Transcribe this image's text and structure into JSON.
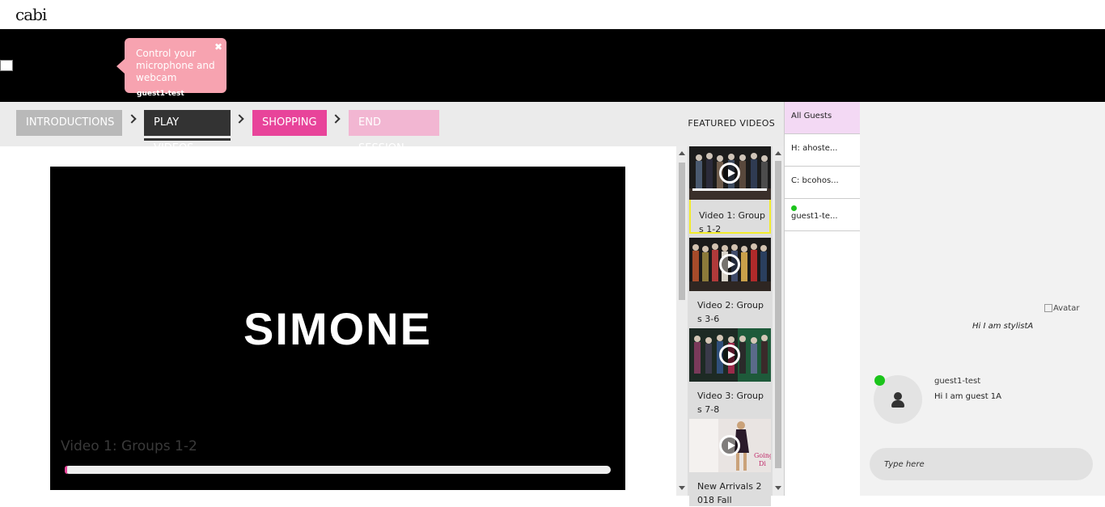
{
  "header": {
    "logo_text": "cabi"
  },
  "banner": {
    "tooltip_text": "Control your microphone and webcam",
    "tooltip_close": "✖",
    "guest_label": "guest1-test"
  },
  "steps": {
    "introductions": "INTRODUCTIONS",
    "play_videos": "PLAY VIDEOS",
    "shopping": "SHOPPING",
    "end_session": "END SESSION",
    "active": "PLAY VIDEOS",
    "featured_videos": "FEATURED VIDEOS"
  },
  "player": {
    "brand_text": "SIMONE",
    "title": "Video 1: Groups 1-2",
    "progress_fraction": 0.004
  },
  "videos": [
    {
      "label": "Video 1: Groups 1-2",
      "active": true,
      "progress_fraction": 1.0
    },
    {
      "label": "Video 2: Groups 3-6",
      "active": false
    },
    {
      "label": "Video 3: Groups 7-8",
      "active": false
    },
    {
      "label": "New Arrivals 2018 Fall",
      "active": false
    }
  ],
  "guests": {
    "all": "All Guests",
    "items": [
      {
        "label": "H: ahoste...",
        "online": false
      },
      {
        "label": "C: bcohos...",
        "online": false
      },
      {
        "label": "guest1-te...",
        "online": true
      }
    ]
  },
  "chat": {
    "avatar_alt": "Avatar",
    "host_message": "Hi I am stylistA",
    "guest_name": "guest1-test",
    "guest_message": "Hi I am guest 1A",
    "input_placeholder": "Type here"
  },
  "colors": {
    "accent_pink": "#e8449a",
    "active_video_border": "#f2ec2b",
    "online_green": "#1bc41b"
  }
}
